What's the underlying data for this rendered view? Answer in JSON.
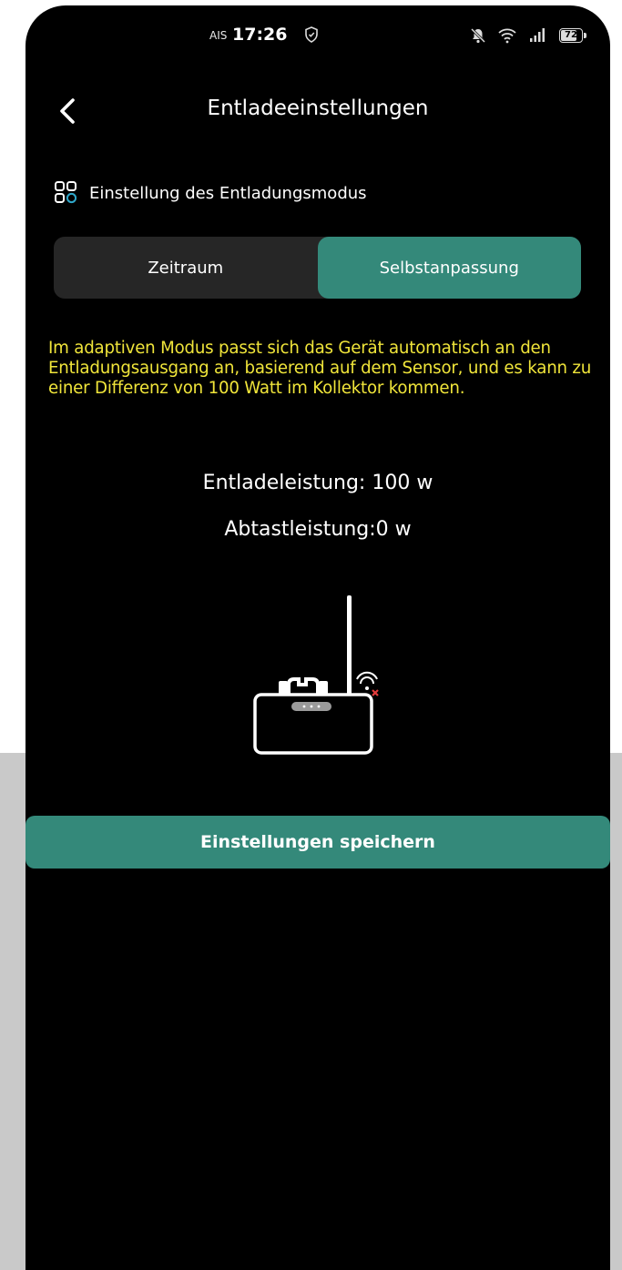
{
  "status_bar": {
    "carrier": "AIS",
    "time": "17:26",
    "battery_level": "72",
    "battery_fraction": 0.72
  },
  "header": {
    "title": "Entladeeinstellungen",
    "back_icon": "chevron-left-icon"
  },
  "section": {
    "icon": "grid-icon",
    "label": "Einstellung des Entladungsmodus"
  },
  "mode_tabs": [
    {
      "label": "Zeitraum",
      "selected": false
    },
    {
      "label": "Selbstanpassung",
      "selected": true
    }
  ],
  "info_text": "Im adaptiven Modus passt sich das Gerät automatisch an den Entladungsausgang an, basierend auf dem Sensor, und es kann zu einer Differenz von 100 Watt im Kollektor kommen.",
  "discharge_power": "Entladeleistung: 100 w",
  "sampling_power": "Abtastleistung:0 w",
  "device": {
    "icon": "device-router-icon",
    "wifi_status": "disconnected"
  },
  "save_button": {
    "label": "Einstellungen speichern"
  },
  "colors": {
    "accent": "#34897a",
    "info_text": "#f0e53a",
    "background": "#000000",
    "segment_bg": "#262626"
  }
}
